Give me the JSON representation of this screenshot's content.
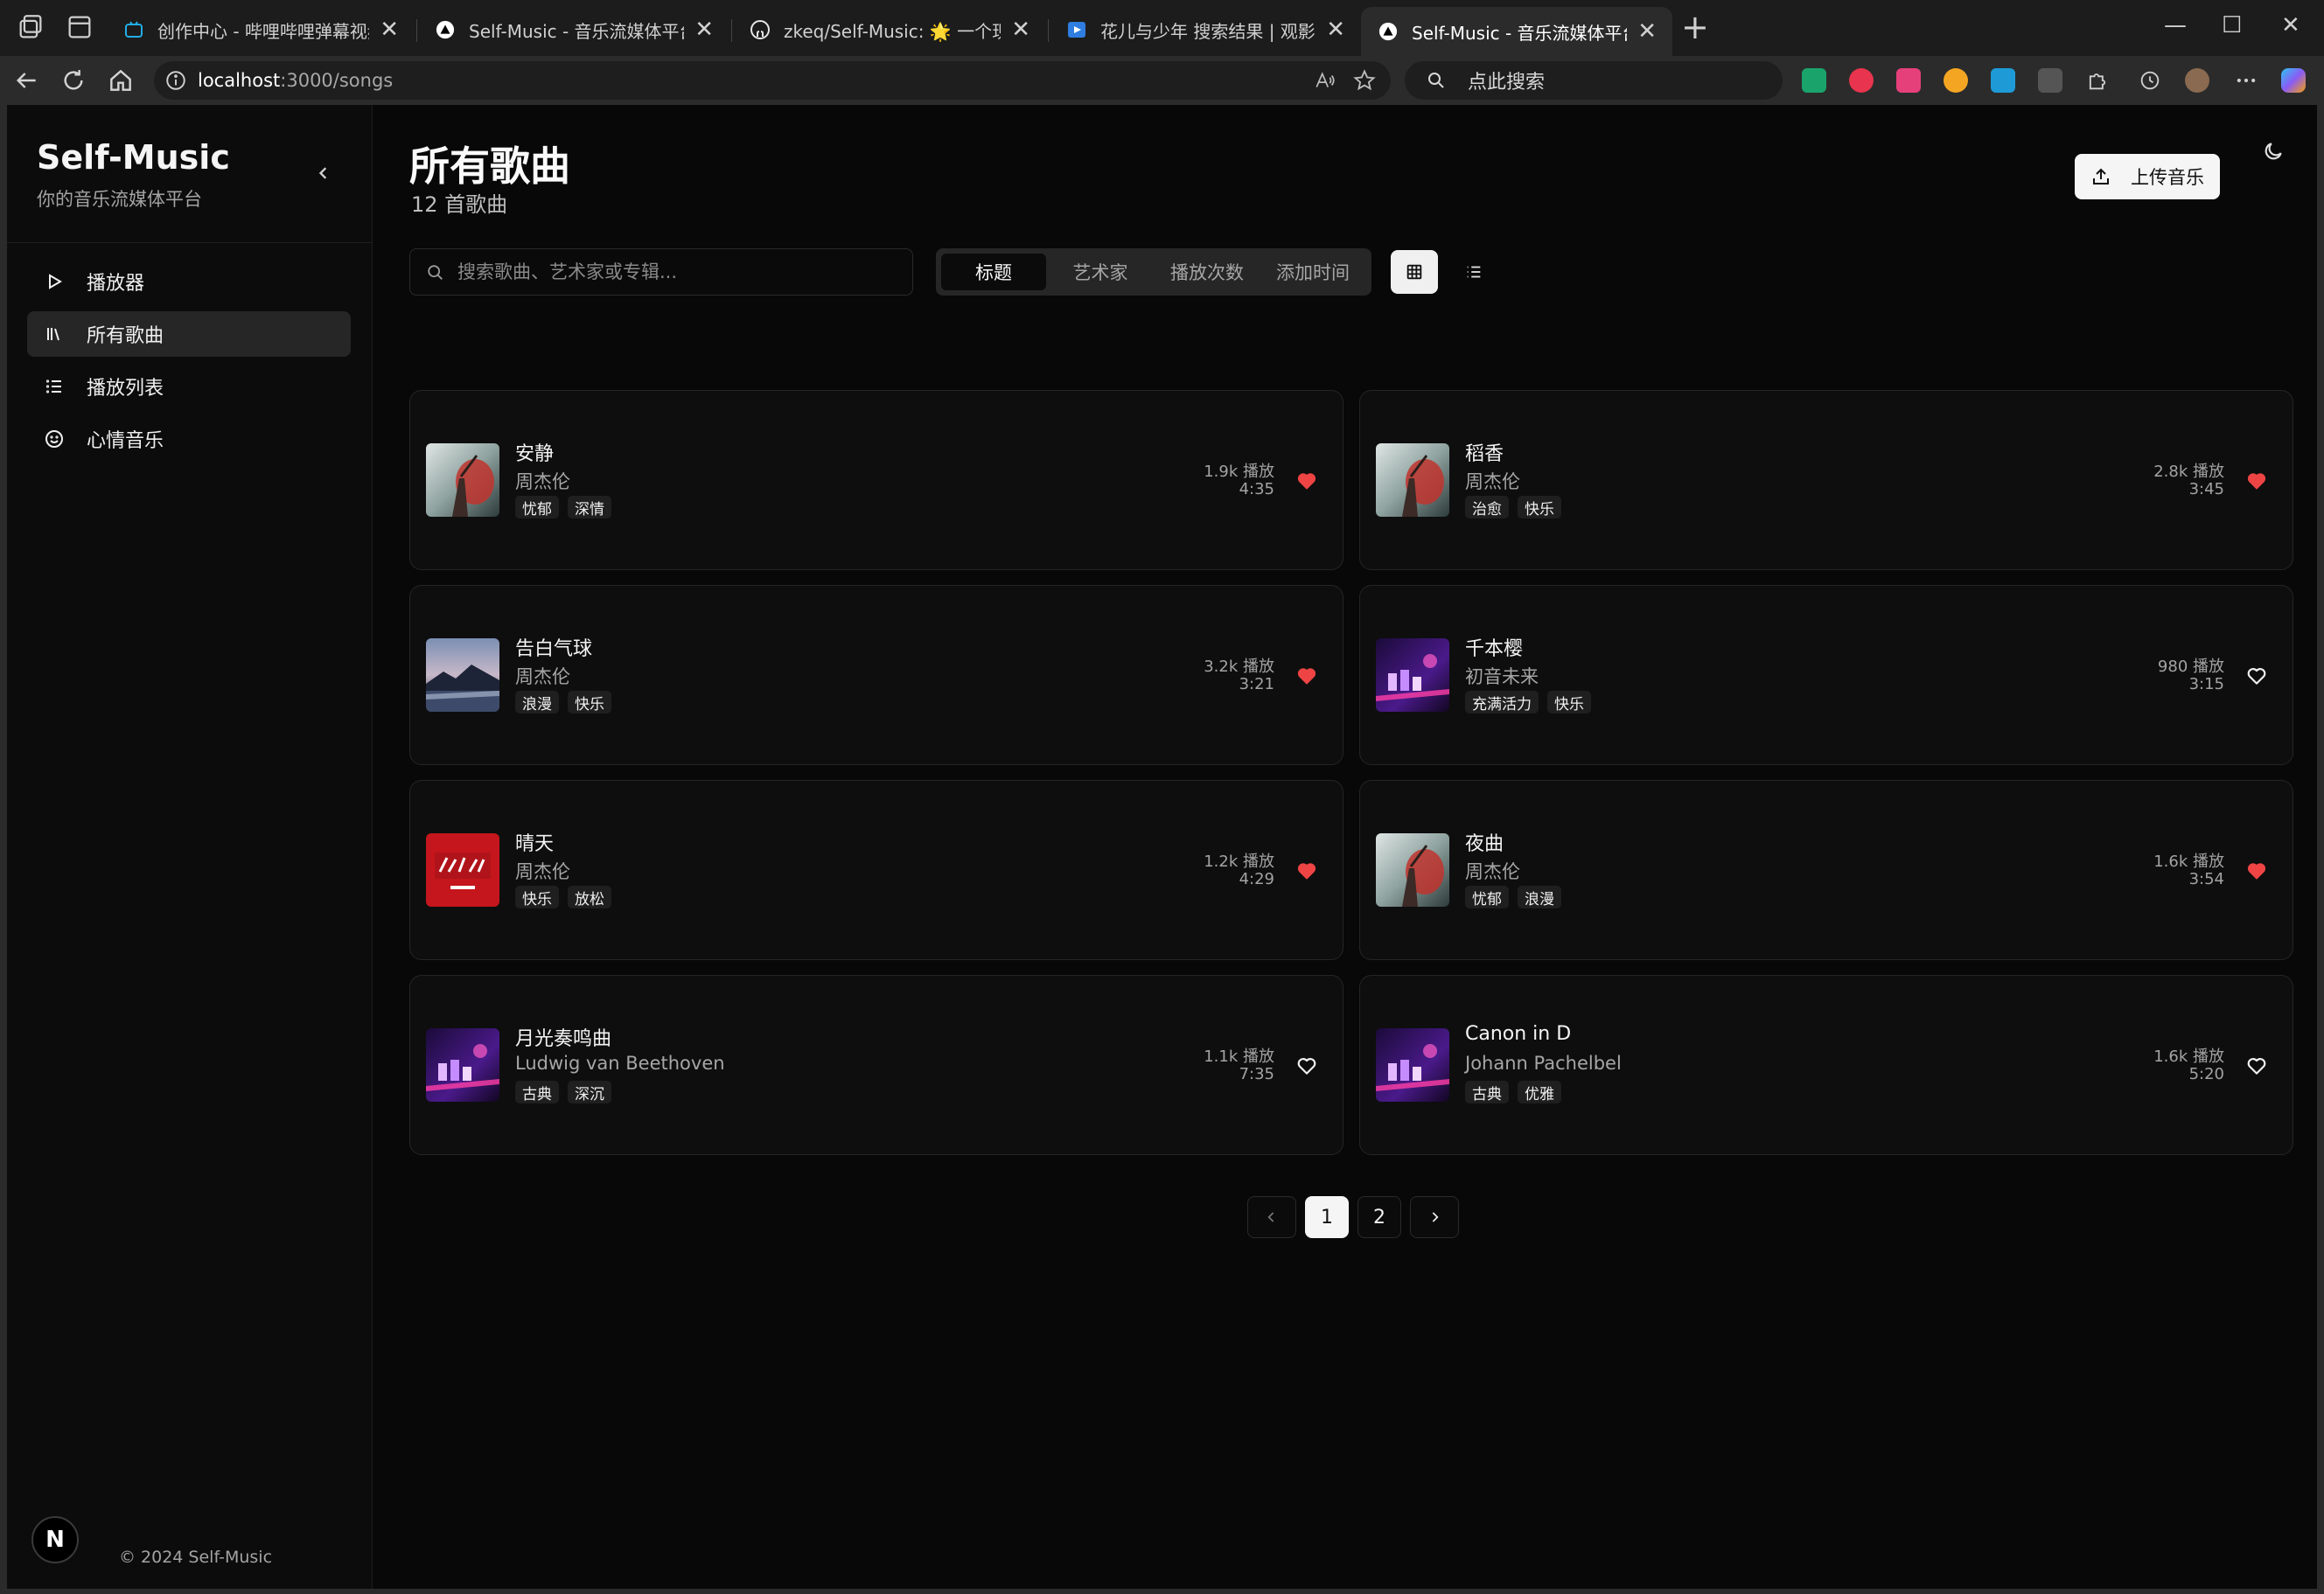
{
  "browser": {
    "tabs": [
      {
        "title": "创作中心 - 哔哩哔哩弹幕视频网 - ",
        "close": "✕"
      },
      {
        "title": "Self-Music - 音乐流媒体平台",
        "close": "✕"
      },
      {
        "title": "zkeq/Self-Music: 🌟 一个现代化的",
        "close": "✕"
      },
      {
        "title": "花儿与少年 搜索结果 | 观影 GYIN",
        "close": "✕"
      },
      {
        "title": "Self-Music - 音乐流媒体平台",
        "close": "✕"
      }
    ],
    "new_tab": "+",
    "win_min": "—",
    "win_max": "☐",
    "win_close": "✕",
    "url_host": "localhost",
    "url_path": ":3000/songs",
    "search_placeholder": "点此搜索",
    "colors": {
      "tabbar": "#1c1c1c",
      "toolbar": "#2b2b2b"
    }
  },
  "sidebar": {
    "brand": "Self-Music",
    "subtitle": "你的音乐流媒体平台",
    "items": [
      {
        "label": "播放器",
        "icon": "play-icon"
      },
      {
        "label": "所有歌曲",
        "icon": "library-icon"
      },
      {
        "label": "播放列表",
        "icon": "list-icon"
      },
      {
        "label": "心情音乐",
        "icon": "smile-icon"
      }
    ],
    "avatar": "N",
    "copyright": "© 2024 Self-Music"
  },
  "header": {
    "title": "所有歌曲",
    "count": "12 首歌曲",
    "upload_label": "上传音乐"
  },
  "toolbar": {
    "search_placeholder": "搜索歌曲、艺术家或专辑...",
    "sort_options": [
      "标题",
      "艺术家",
      "播放次数",
      "添加时间"
    ],
    "active_sort": "标题"
  },
  "songs": [
    {
      "title": "安静",
      "artist": "周杰伦",
      "tags": [
        "忧郁",
        "深情"
      ],
      "plays": "1.9k 播放",
      "duration": "4:35",
      "liked": true
    },
    {
      "title": "稻香",
      "artist": "周杰伦",
      "tags": [
        "治愈",
        "快乐"
      ],
      "plays": "2.8k 播放",
      "duration": "3:45",
      "liked": true
    },
    {
      "title": "告白气球",
      "artist": "周杰伦",
      "tags": [
        "浪漫",
        "快乐"
      ],
      "plays": "3.2k 播放",
      "duration": "3:21",
      "liked": true
    },
    {
      "title": "千本樱",
      "artist": "初音未来",
      "tags": [
        "充满活力",
        "快乐"
      ],
      "plays": "980 播放",
      "duration": "3:15",
      "liked": false
    },
    {
      "title": "晴天",
      "artist": "周杰伦",
      "tags": [
        "快乐",
        "放松"
      ],
      "plays": "1.2k 播放",
      "duration": "4:29",
      "liked": true
    },
    {
      "title": "夜曲",
      "artist": "周杰伦",
      "tags": [
        "忧郁",
        "浪漫"
      ],
      "plays": "1.6k 播放",
      "duration": "3:54",
      "liked": true
    },
    {
      "title": "月光奏鸣曲",
      "artist": "Ludwig van Beethoven",
      "tags": [
        "古典",
        "深沉"
      ],
      "plays": "1.1k 播放",
      "duration": "7:35",
      "liked": false
    },
    {
      "title": "Canon in D",
      "artist": "Johann Pachelbel",
      "tags": [
        "古典",
        "优雅"
      ],
      "plays": "1.6k 播放",
      "duration": "5:20",
      "liked": false
    }
  ],
  "pagination": {
    "pages": [
      "1",
      "2"
    ],
    "current": "1"
  },
  "colors": {
    "liked": "#ef4444",
    "background": "#080808",
    "card": "#0e0e0e"
  }
}
